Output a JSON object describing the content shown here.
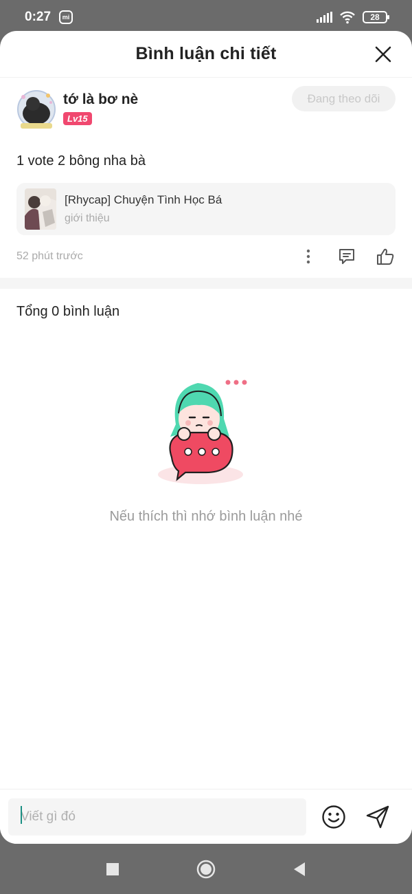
{
  "status_bar": {
    "time": "0:27",
    "mi_label": "mi",
    "battery": "28"
  },
  "header": {
    "title": "Bình luận chi tiết"
  },
  "post": {
    "author_name": "tớ là bơ nè",
    "level": "Lv15",
    "follow_label": "Đang theo dõi",
    "text": "1 vote 2 bông nha bà",
    "book": {
      "title": "[Rhycap] Chuyện Tình Học Bá",
      "subtitle": "giới thiệu"
    },
    "time": "52 phút trước"
  },
  "comments": {
    "total_label": "Tổng 0 bình luận",
    "empty_text": "Nếu thích thì nhớ bình luận nhé"
  },
  "input": {
    "placeholder": "Viết gì đó"
  },
  "colors": {
    "accent_pink": "#f0486f",
    "mascot_hair": "#4fd8b0",
    "mascot_bubble": "#ef4a62"
  }
}
